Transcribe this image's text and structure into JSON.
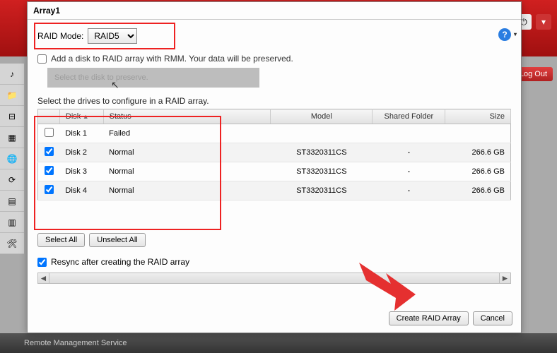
{
  "background": {
    "logout": "Log Out",
    "rms": "Remote Management\nService"
  },
  "dialog": {
    "title": "Array1",
    "raid_mode_label": "RAID Mode:",
    "raid_mode_value": "RAID5",
    "rmm_label": "Add a disk to RAID array with RMM. Your data will be preserved.",
    "disabled_text": "Select the disk to preserve.",
    "instruct": "Select the drives to configure in a RAID array.",
    "columns": {
      "disk": "Disk",
      "status": "Status",
      "model": "Model",
      "shared": "Shared Folder",
      "size": "Size"
    },
    "rows": [
      {
        "checked": false,
        "disk": "Disk 1",
        "status": "Failed",
        "model": "",
        "shared": "",
        "size": ""
      },
      {
        "checked": true,
        "disk": "Disk 2",
        "status": "Normal",
        "model": "ST3320311CS",
        "shared": "-",
        "size": "266.6 GB"
      },
      {
        "checked": true,
        "disk": "Disk 3",
        "status": "Normal",
        "model": "ST3320311CS",
        "shared": "-",
        "size": "266.6 GB"
      },
      {
        "checked": true,
        "disk": "Disk 4",
        "status": "Normal",
        "model": "ST3320311CS",
        "shared": "-",
        "size": "266.6 GB"
      }
    ],
    "select_all": "Select All",
    "unselect_all": "Unselect All",
    "resync_label": "Resync after creating the RAID array",
    "create": "Create RAID Array",
    "cancel": "Cancel"
  }
}
